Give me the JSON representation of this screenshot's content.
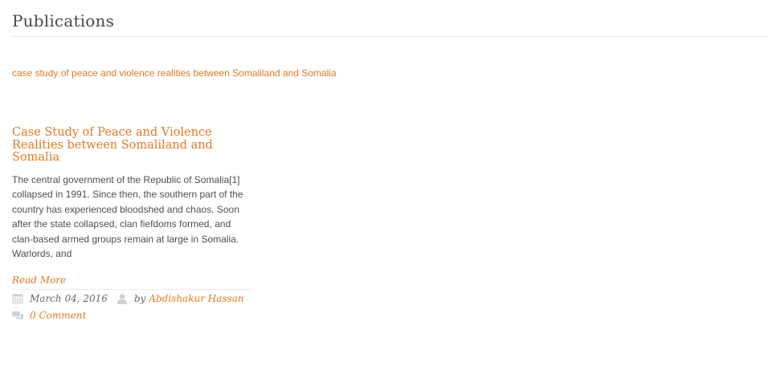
{
  "page": {
    "title": "Publications"
  },
  "category": {
    "link_text": "case study of peace and violence realities between Somaliland and Somalia"
  },
  "post": {
    "title": "Case Study of Peace and Violence Realities between Somaliland and Somalia",
    "excerpt": "  The central government of the Republic of Somalia[1] collapsed in 1991. Since then, the southern part of the country has experienced bloodshed and chaos. Soon after the state collapsed, clan fiefdoms formed, and clan-based armed groups remain at large in Somalia. Warlords, and",
    "read_more": "Read More",
    "date": "March 04, 2016",
    "author_prefix": "by",
    "author": "Abdishakur Hassan",
    "comments": "0 Comment"
  },
  "icons": {
    "date": "calendar-icon",
    "author": "user-icon",
    "comments": "comment-icon"
  },
  "colors": {
    "accent": "#e07b24",
    "text": "#4f4f4f",
    "icon": "#cccccc"
  }
}
